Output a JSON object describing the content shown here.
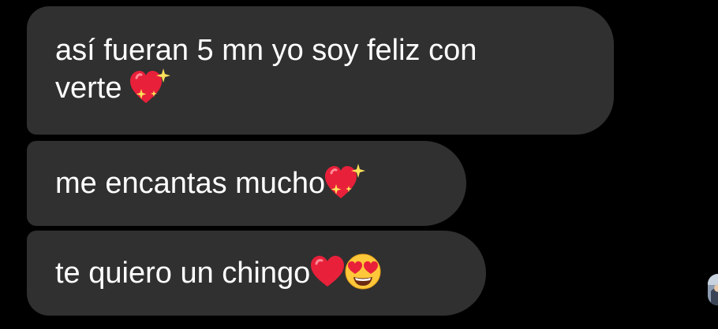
{
  "messages": [
    {
      "line1": "así fueran 5 mn yo soy feliz con",
      "line2": "verte",
      "emoji": "sparkling-heart"
    },
    {
      "text": "me encantas mucho",
      "emoji": "sparkling-heart"
    },
    {
      "text": "te quiero un chingo",
      "emojis": [
        "red-heart",
        "heart-eyes-face"
      ]
    }
  ],
  "colors": {
    "background": "#000000",
    "bubble": "#303030",
    "text": "#ffffff",
    "heart": "#e8203a",
    "sparkle": "#ffe15a",
    "face": "#ffc83a"
  },
  "avatar": {
    "icon": "profile-avatar"
  }
}
